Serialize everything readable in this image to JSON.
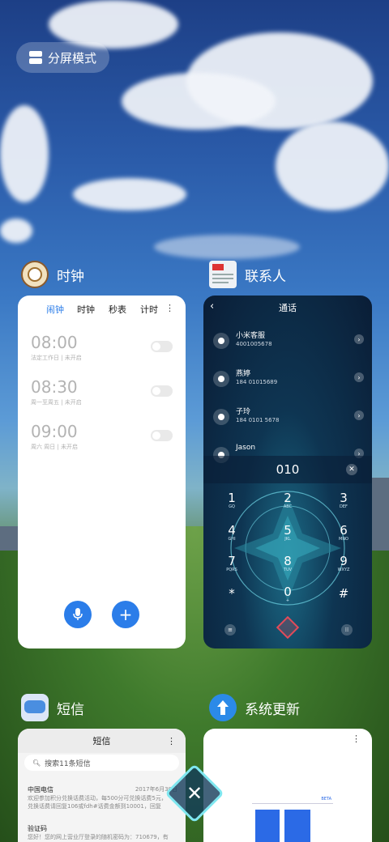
{
  "split_mode": {
    "label": "分屏模式",
    "icon": "split-screen-icon"
  },
  "apps": {
    "clock": {
      "title": "时钟",
      "icon": "clock-app-icon",
      "tabs": [
        "闹钟",
        "时钟",
        "秒表",
        "计时"
      ],
      "active_tab": "闹钟",
      "more": "⋮",
      "alarms": [
        {
          "time": "08:00",
          "sub": "法定工作日 | 未开启",
          "enabled": false
        },
        {
          "time": "08:30",
          "sub": "周一至周五 | 未开启",
          "enabled": false
        },
        {
          "time": "09:00",
          "sub": "周六 周日 | 未开启",
          "enabled": false
        }
      ],
      "accent": "#2b7de9"
    },
    "contacts": {
      "title": "联系人",
      "icon": "contacts-app-icon",
      "header": "通话",
      "list": [
        {
          "name": "小米客服",
          "number": "4001005678"
        },
        {
          "name": "燕婷",
          "number": "184 01015689"
        },
        {
          "name": "子玲",
          "number": "184 0101 5678"
        },
        {
          "name": "Jason",
          "number": ""
        }
      ],
      "dial_value": "010",
      "keys": [
        {
          "d": "1",
          "l": "GQ"
        },
        {
          "d": "2",
          "l": "ABC"
        },
        {
          "d": "3",
          "l": "DEF"
        },
        {
          "d": "4",
          "l": "GHI"
        },
        {
          "d": "5",
          "l": "JKL"
        },
        {
          "d": "6",
          "l": "MNO"
        },
        {
          "d": "7",
          "l": "PQRS"
        },
        {
          "d": "8",
          "l": "TUV"
        },
        {
          "d": "9",
          "l": "WXYZ"
        },
        {
          "d": "*",
          "l": ""
        },
        {
          "d": "0",
          "l": "+"
        },
        {
          "d": "#",
          "l": ""
        }
      ]
    },
    "sms": {
      "title": "短信",
      "icon": "sms-app-icon",
      "header": "短信",
      "search_placeholder": "搜索11条短信",
      "items": [
        {
          "sender": "中国电信",
          "date": "2017年6月30日",
          "preview1": "欢迎参加积分兑换话费活动，每500分可兑换话费5元，",
          "preview2": "兑换话费请回复106或fdh#话费金额到10001，回复"
        },
        {
          "sender": "验证码",
          "date": "",
          "preview1": "您好！您的网上营业厅登录的随机密码为：710679，有",
          "preview2": ""
        }
      ]
    },
    "update": {
      "title": "系统更新",
      "icon": "system-update-icon",
      "badge": "BETA",
      "more": "⋮"
    }
  }
}
